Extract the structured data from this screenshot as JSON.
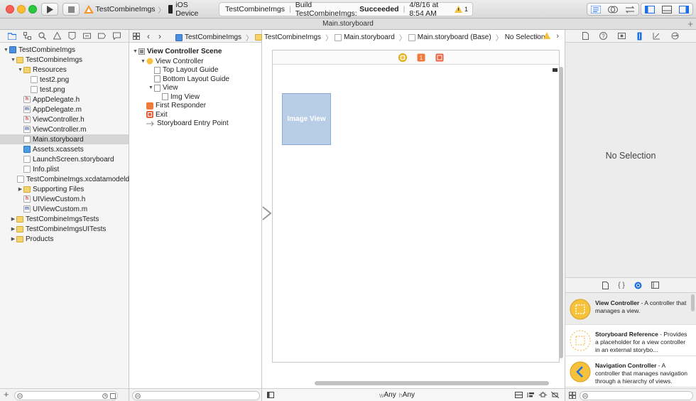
{
  "toolbar": {
    "scheme_target": "TestCombineImgs",
    "scheme_device": "iOS Device",
    "activity_project": "TestCombineImgs",
    "activity_status_prefix": "Build TestCombineImgs:",
    "activity_status": "Succeeded",
    "activity_time": "4/8/16 at 8:54 AM",
    "warning_count": "1"
  },
  "tab": {
    "title": "Main.storyboard"
  },
  "navigator": {
    "items": [
      {
        "label": "TestCombineImgs",
        "indent": 0,
        "icon": "proj",
        "disc": "▼"
      },
      {
        "label": "TestCombineImgs",
        "indent": 1,
        "icon": "folder",
        "disc": "▼"
      },
      {
        "label": "Resources",
        "indent": 2,
        "icon": "folder",
        "disc": "▼"
      },
      {
        "label": "test2.png",
        "indent": 3,
        "icon": "png",
        "disc": ""
      },
      {
        "label": "test.png",
        "indent": 3,
        "icon": "png",
        "disc": ""
      },
      {
        "label": "AppDelegate.h",
        "indent": 2,
        "icon": "hfile",
        "disc": ""
      },
      {
        "label": "AppDelegate.m",
        "indent": 2,
        "icon": "mfile",
        "disc": ""
      },
      {
        "label": "ViewController.h",
        "indent": 2,
        "icon": "hfile",
        "disc": ""
      },
      {
        "label": "ViewController.m",
        "indent": 2,
        "icon": "mfile",
        "disc": ""
      },
      {
        "label": "Main.storyboard",
        "indent": 2,
        "icon": "sb",
        "disc": "",
        "selected": true
      },
      {
        "label": "Assets.xcassets",
        "indent": 2,
        "icon": "assets",
        "disc": ""
      },
      {
        "label": "LaunchScreen.storyboard",
        "indent": 2,
        "icon": "sb",
        "disc": ""
      },
      {
        "label": "Info.plist",
        "indent": 2,
        "icon": "png",
        "disc": ""
      },
      {
        "label": "TestCombineImgs.xcdatamodeld",
        "indent": 2,
        "icon": "png",
        "disc": ""
      },
      {
        "label": "Supporting Files",
        "indent": 2,
        "icon": "folder",
        "disc": "▶"
      },
      {
        "label": "UIViewCustom.h",
        "indent": 2,
        "icon": "hfile",
        "disc": ""
      },
      {
        "label": "UIViewCustom.m",
        "indent": 2,
        "icon": "mfile",
        "disc": ""
      },
      {
        "label": "TestCombineImgsTests",
        "indent": 1,
        "icon": "folder",
        "disc": "▶"
      },
      {
        "label": "TestCombineImgsUITests",
        "indent": 1,
        "icon": "folder",
        "disc": "▶"
      },
      {
        "label": "Products",
        "indent": 1,
        "icon": "folder",
        "disc": "▶"
      }
    ]
  },
  "breadcrumbs": [
    "TestCombineImgs",
    "TestCombineImgs",
    "Main.storyboard",
    "Main.storyboard (Base)",
    "No Selection"
  ],
  "outline": {
    "scene_title": "View Controller Scene",
    "items": [
      {
        "label": "View Controller",
        "indent": 1,
        "disc": "▼"
      },
      {
        "label": "Top Layout Guide",
        "indent": 2,
        "disc": ""
      },
      {
        "label": "Bottom Layout Guide",
        "indent": 2,
        "disc": ""
      },
      {
        "label": "View",
        "indent": 2,
        "disc": "▼"
      },
      {
        "label": "Img View",
        "indent": 3,
        "disc": ""
      },
      {
        "label": "First Responder",
        "indent": 1,
        "disc": ""
      },
      {
        "label": "Exit",
        "indent": 1,
        "disc": ""
      },
      {
        "label": "Storyboard Entry Point",
        "indent": 1,
        "disc": ""
      }
    ]
  },
  "canvas": {
    "image_view_label": "Image View",
    "size_w_prefix": "w",
    "size_w": "Any",
    "size_h_prefix": "h",
    "size_h": "Any"
  },
  "inspector": {
    "no_selection": "No Selection",
    "library": [
      {
        "title": "View Controller",
        "desc": " - A controller that manages a view."
      },
      {
        "title": "Storyboard Reference",
        "desc": " - Provides a placeholder for a view controller in an external storybo..."
      },
      {
        "title": "Navigation Controller",
        "desc": " - A controller that manages navigation through a hierarchy of views."
      }
    ]
  },
  "colors": {
    "accent": "#1c6fe3",
    "selection": "#d5d5d5",
    "image_view_fill": "#b8cde6"
  }
}
